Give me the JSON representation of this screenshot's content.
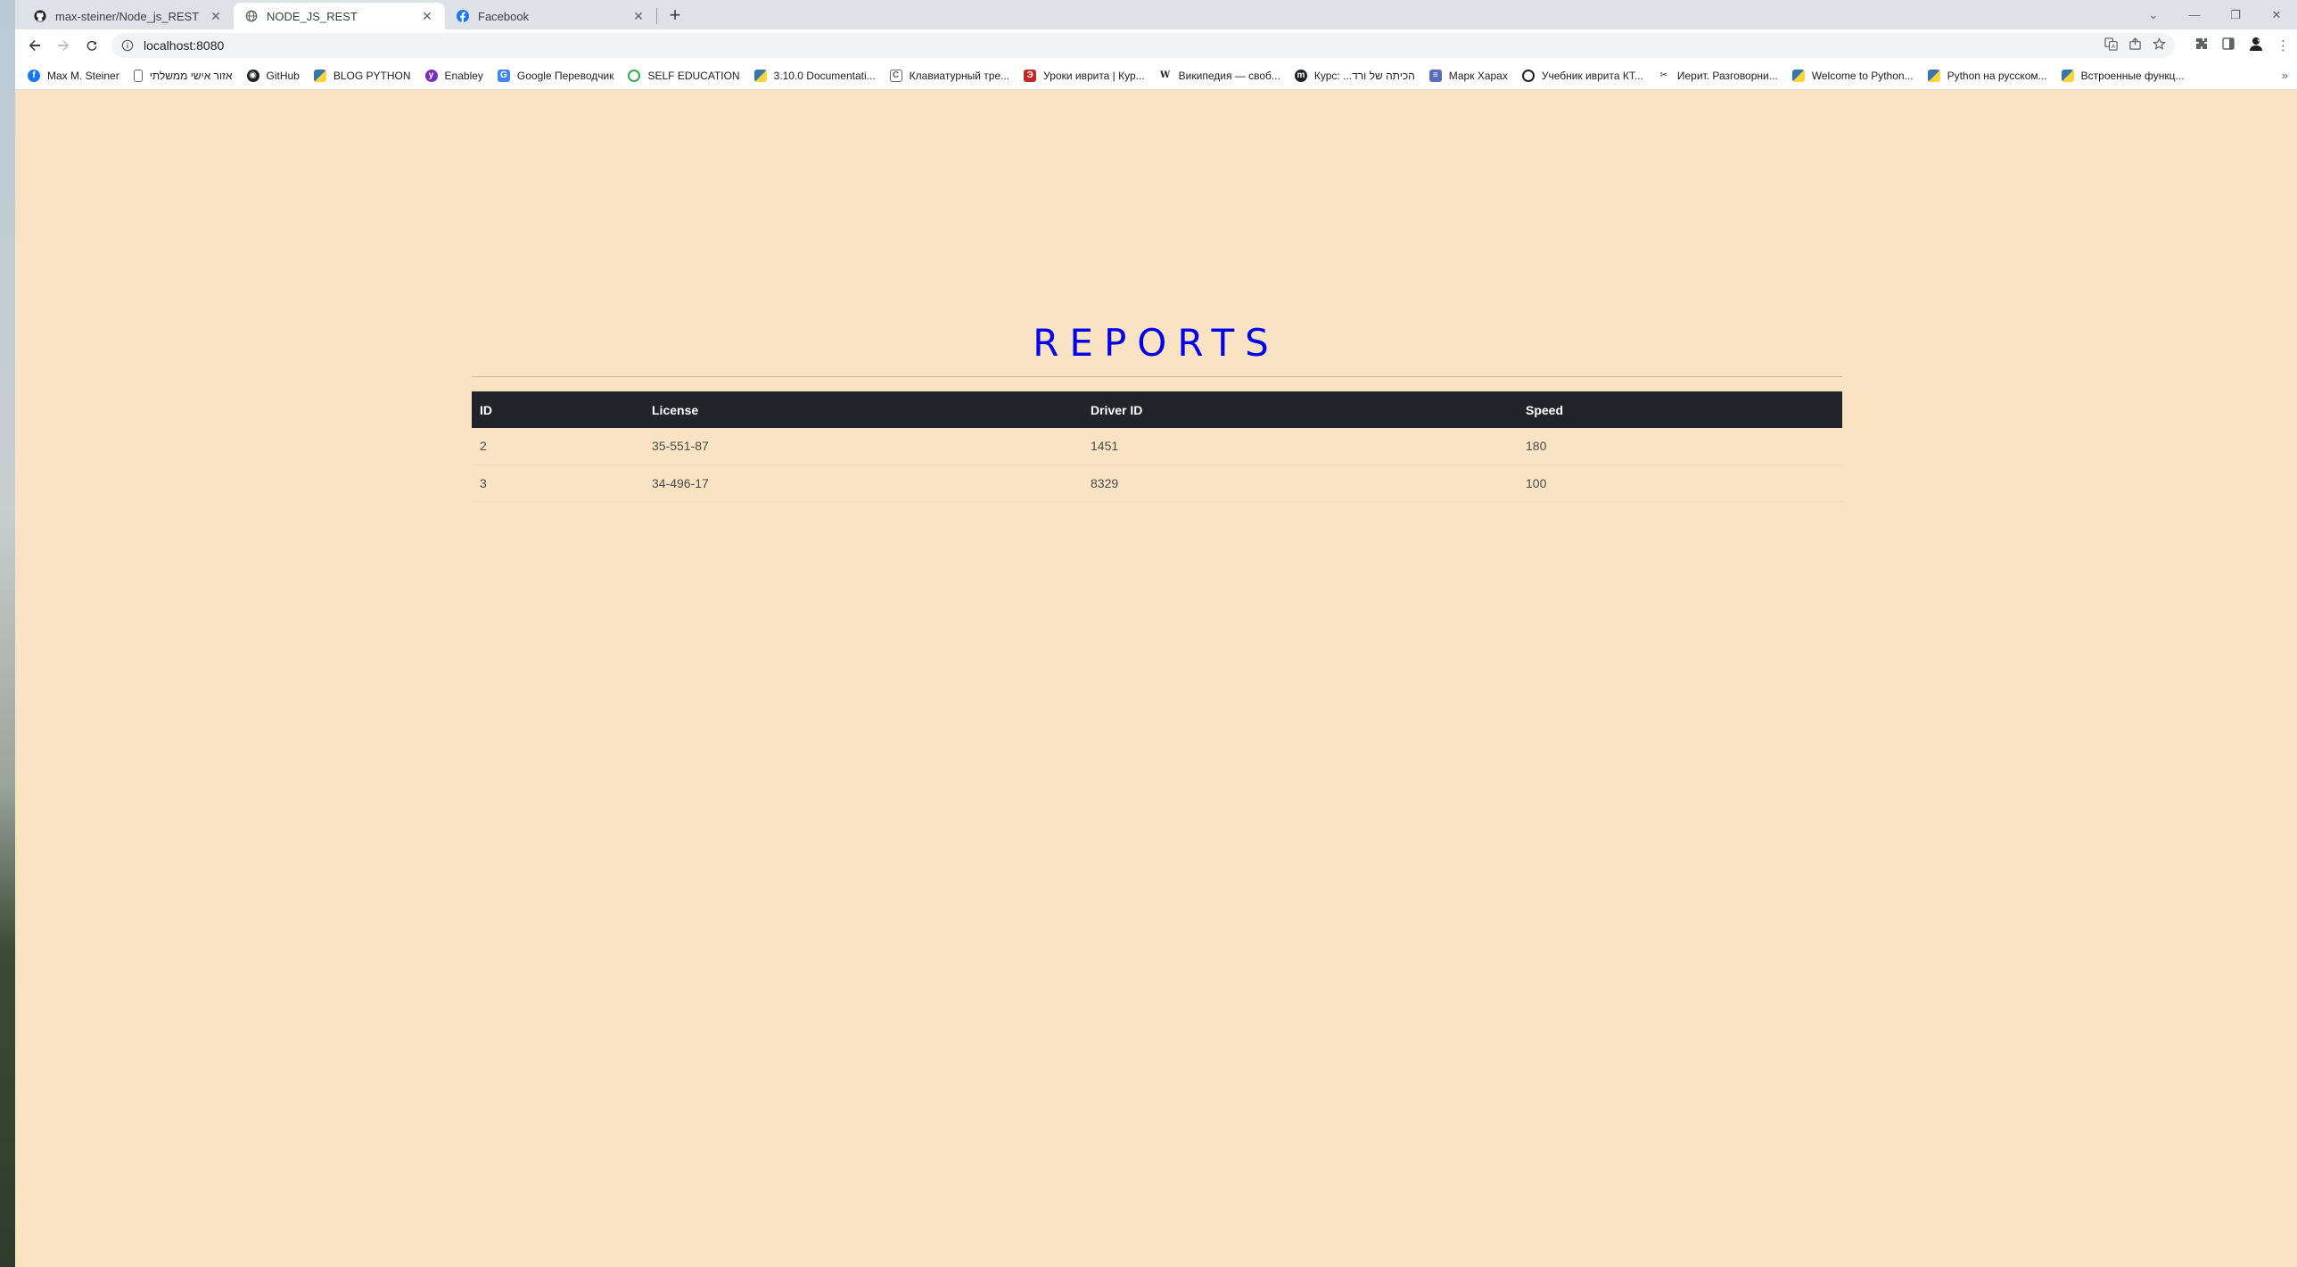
{
  "browser": {
    "tabs": [
      {
        "title": "max-steiner/Node_js_REST",
        "icon": "github-icon",
        "active": false
      },
      {
        "title": "NODE_JS_REST",
        "icon": "globe-icon",
        "active": true
      },
      {
        "title": "Facebook",
        "icon": "facebook-icon",
        "active": false
      }
    ],
    "new_tab_glyph": "+",
    "url": "localhost:8080",
    "bookmarks": [
      {
        "label": "Max M. Steiner",
        "icon": "facebook-icon",
        "color": "#1877f2"
      },
      {
        "label": "אזור אישי ממשלתי",
        "icon": "document-icon",
        "color": "#5f6368"
      },
      {
        "label": "GitHub",
        "icon": "github-icon",
        "color": "#202124"
      },
      {
        "label": "BLOG PYTHON",
        "icon": "python-icon",
        "color": "#3776ab"
      },
      {
        "label": "Enabley",
        "icon": "enabley-icon",
        "color": "#7b2cbf"
      },
      {
        "label": "Google Переводчик",
        "icon": "translate-icon",
        "color": "#4285f4"
      },
      {
        "label": "SELF EDUCATION",
        "icon": "globe-icon",
        "color": "#34a853"
      },
      {
        "label": "3.10.0 Documentati...",
        "icon": "python-icon",
        "color": "#3776ab"
      },
      {
        "label": "Клавиатурный тре...",
        "icon": "copyright-icon",
        "color": "#5f6368"
      },
      {
        "label": "Уроки иврита | Кур...",
        "icon": "lesson-icon",
        "color": "#c62828"
      },
      {
        "label": "Википедия — своб...",
        "icon": "wikipedia-icon",
        "color": "#202124"
      },
      {
        "label": "Курс: ...הכיתה של ורד",
        "icon": "moodle-icon",
        "color": "#202124"
      },
      {
        "label": "Марк Харах",
        "icon": "books-icon",
        "color": "#5c6bc0"
      },
      {
        "label": "Учебник иврита КТ...",
        "icon": "globe-icon",
        "color": "#202124"
      },
      {
        "label": "Иерит. Разговорни...",
        "icon": "scissors-icon",
        "color": "#202124"
      },
      {
        "label": "Welcome to Python...",
        "icon": "python-icon",
        "color": "#3776ab"
      },
      {
        "label": "Python на русском...",
        "icon": "python-icon",
        "color": "#3776ab"
      },
      {
        "label": "Встроенные функц...",
        "icon": "python-icon",
        "color": "#3776ab"
      }
    ],
    "bookmarks_more_glyph": "»"
  },
  "page": {
    "title": "REPORTS",
    "title_color": "#0000ee",
    "background": "#fae3c3",
    "table": {
      "columns": [
        "ID",
        "License",
        "Driver ID",
        "Speed"
      ],
      "rows": [
        [
          "2",
          "35-551-87",
          "1451",
          "180"
        ],
        [
          "3",
          "34-496-17",
          "8329",
          "100"
        ]
      ]
    }
  }
}
